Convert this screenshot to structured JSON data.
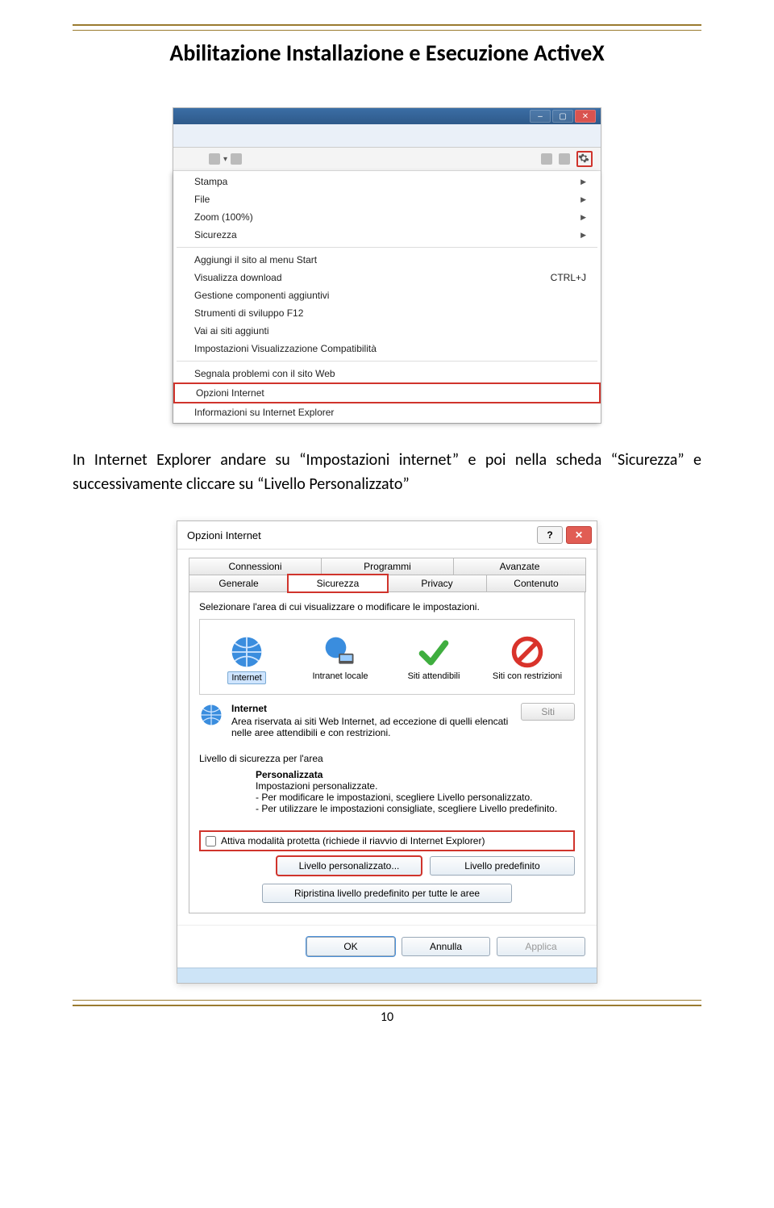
{
  "doc": {
    "title": "Abilitazione Installazione e Esecuzione ActiveX",
    "body_text": "In Internet Explorer andare su “Impostazioni internet” e poi nella scheda “Sicurezza” e successivamente cliccare su “Livello Personalizzato”",
    "page_number": "10"
  },
  "tools_menu": {
    "items_group1": [
      {
        "label": "Stampa",
        "arrow": true
      },
      {
        "label": "File",
        "arrow": true
      },
      {
        "label": "Zoom (100%)",
        "arrow": true
      },
      {
        "label": "Sicurezza",
        "arrow": true
      }
    ],
    "items_group2": [
      {
        "label": "Aggiungi il sito al menu Start",
        "arrow": false
      },
      {
        "label": "Visualizza download",
        "arrow": false,
        "shortcut": "CTRL+J"
      },
      {
        "label": "Gestione componenti aggiuntivi",
        "arrow": false
      },
      {
        "label": "Strumenti di sviluppo F12",
        "arrow": false
      },
      {
        "label": "Vai ai siti aggiunti",
        "arrow": false
      },
      {
        "label": "Impostazioni Visualizzazione Compatibilità",
        "arrow": false
      }
    ],
    "items_group3": [
      {
        "label": "Segnala problemi con il sito Web",
        "arrow": false
      },
      {
        "label": "Opzioni Internet",
        "arrow": false,
        "highlighted": true
      },
      {
        "label": "Informazioni su Internet Explorer",
        "arrow": false
      }
    ]
  },
  "dialog": {
    "title": "Opzioni Internet",
    "tabs_row1": [
      "Connessioni",
      "Programmi",
      "Avanzate"
    ],
    "tabs_row2": [
      "Generale",
      "Sicurezza",
      "Privacy",
      "Contenuto"
    ],
    "active_tab": "Sicurezza",
    "zone_prompt": "Selezionare l'area di cui visualizzare o modificare le impostazioni.",
    "zones": [
      {
        "key": "internet",
        "label": "Internet",
        "selected": true
      },
      {
        "key": "intranet",
        "label": "Intranet locale"
      },
      {
        "key": "trusted",
        "label": "Siti attendibili"
      },
      {
        "key": "restricted",
        "label": "Siti con restrizioni"
      }
    ],
    "desc_title": "Internet",
    "desc_text": "Area riservata ai siti Web Internet, ad eccezione di quelli elencati nelle aree attendibili e con restrizioni.",
    "siti_btn": "Siti",
    "sec_level_label": "Livello di sicurezza per l'area",
    "personal_title": "Personalizzata",
    "personal_lines": [
      "Impostazioni personalizzate.",
      "- Per modificare le impostazioni, scegliere Livello personalizzato.",
      "- Per utilizzare le impostazioni consigliate, scegliere Livello predefinito."
    ],
    "protected_mode": "Attiva modalità protetta (richiede il riavvio di Internet Explorer)",
    "btn_custom": "Livello personalizzato...",
    "btn_default": "Livello predefinito",
    "btn_reset": "Ripristina livello predefinito per tutte le aree",
    "btn_ok": "OK",
    "btn_cancel": "Annulla",
    "btn_apply": "Applica"
  }
}
